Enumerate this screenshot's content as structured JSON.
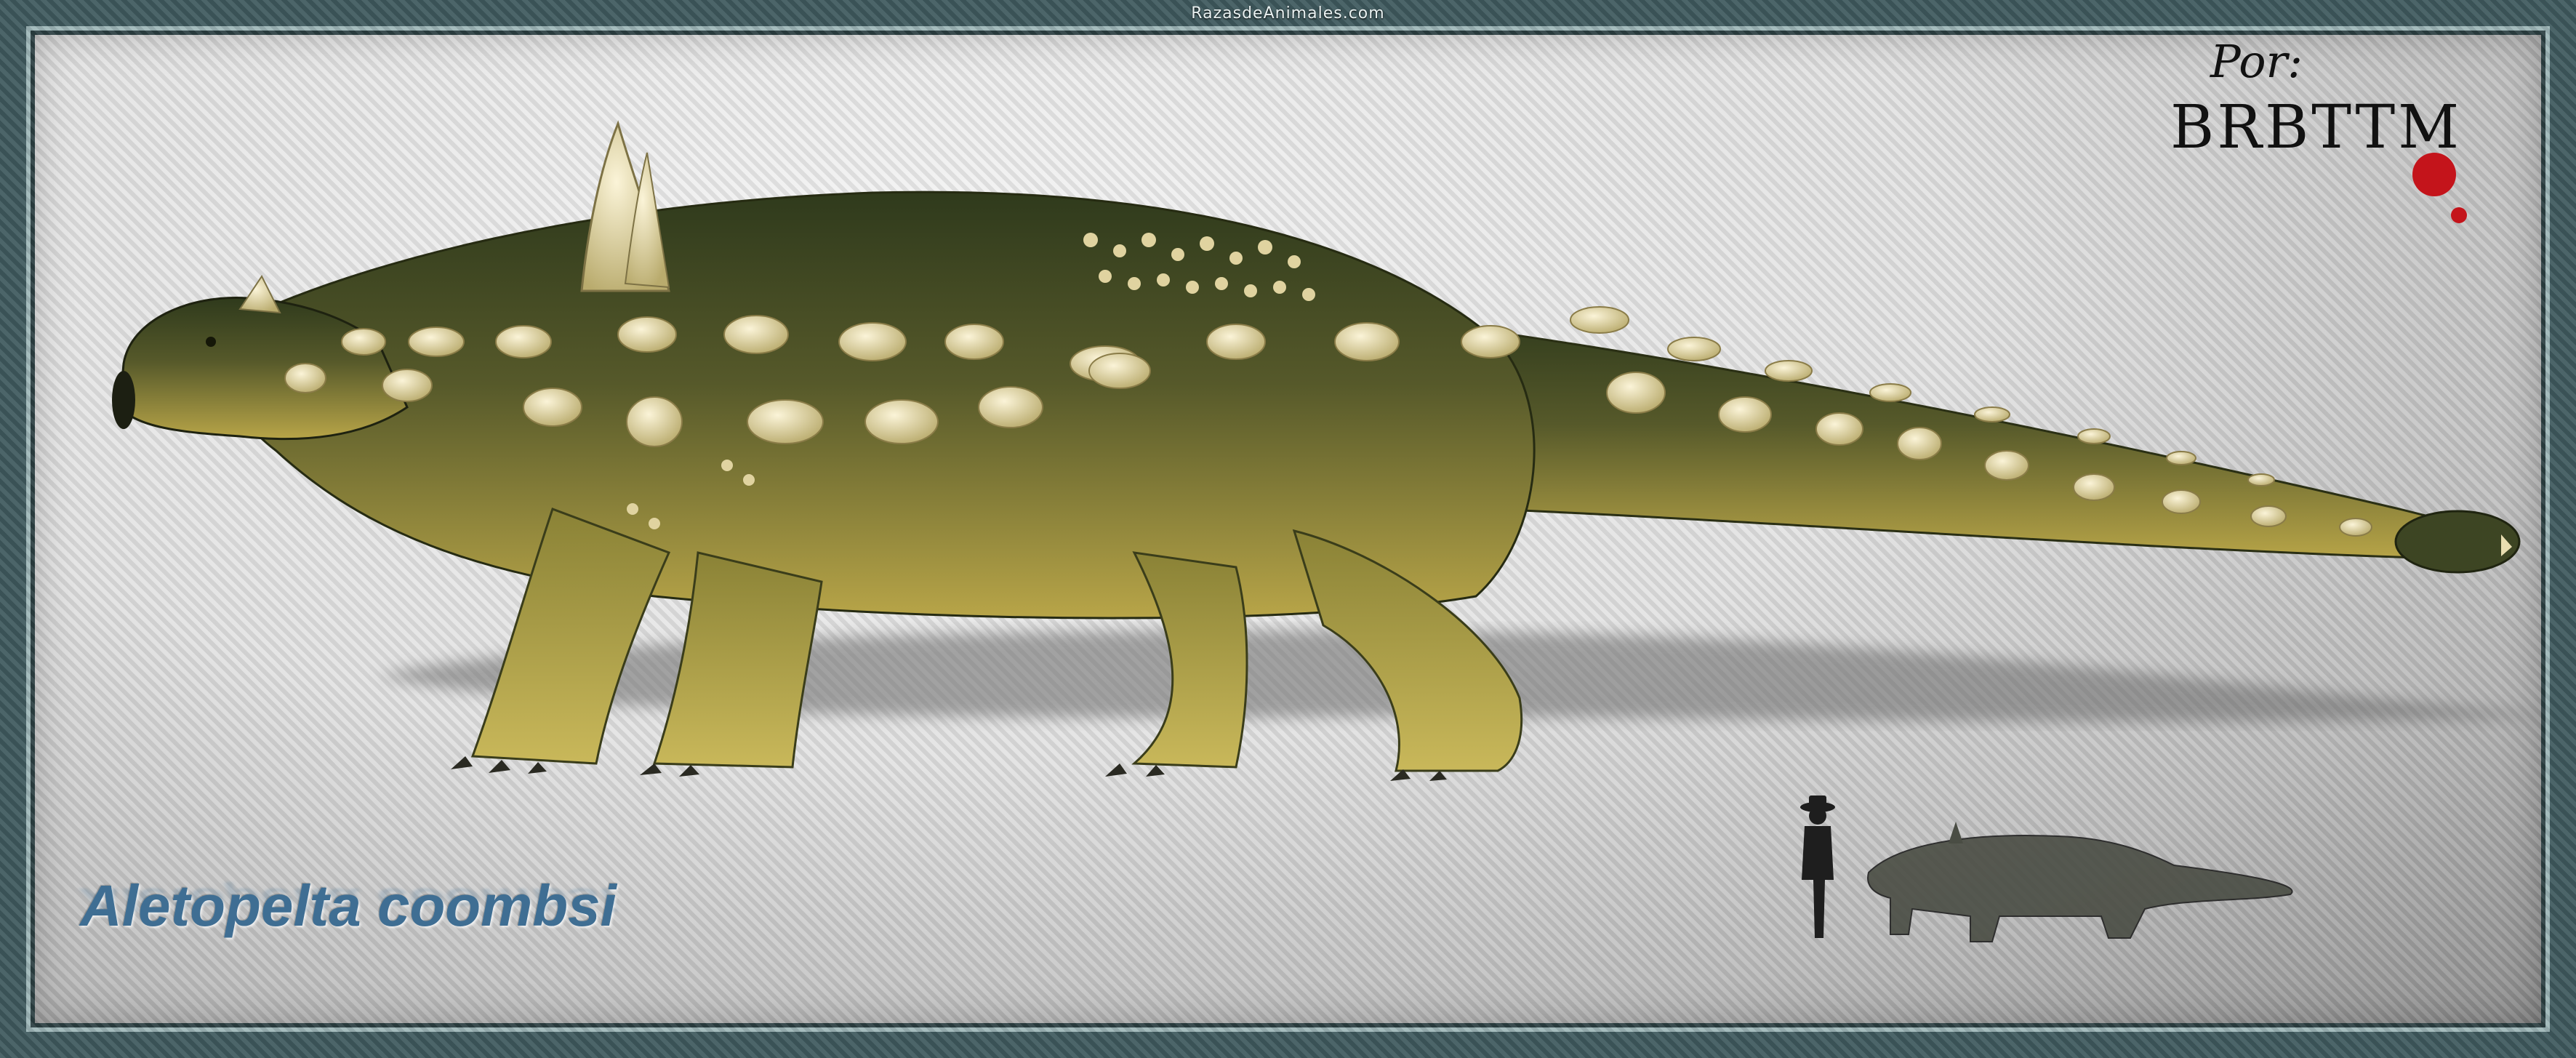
{
  "site": {
    "label": "RazasdeAnimales.com"
  },
  "title": {
    "species": "Aletopelta coombsi"
  },
  "artist": {
    "by": "Por:",
    "name": "BRBTTM"
  },
  "colors": {
    "frame": "#3f5a5e",
    "title": "#3f6e93",
    "skin_light": "#b8a548",
    "skin_dark": "#2f3a1c",
    "osteoderm": "#e8ddb0",
    "blood": "#c4141b"
  },
  "illustration": {
    "subject": "ankylosaur-body",
    "scale_figures": [
      "human-silhouette-icon",
      "ankylosaur-silhouette-icon"
    ]
  }
}
